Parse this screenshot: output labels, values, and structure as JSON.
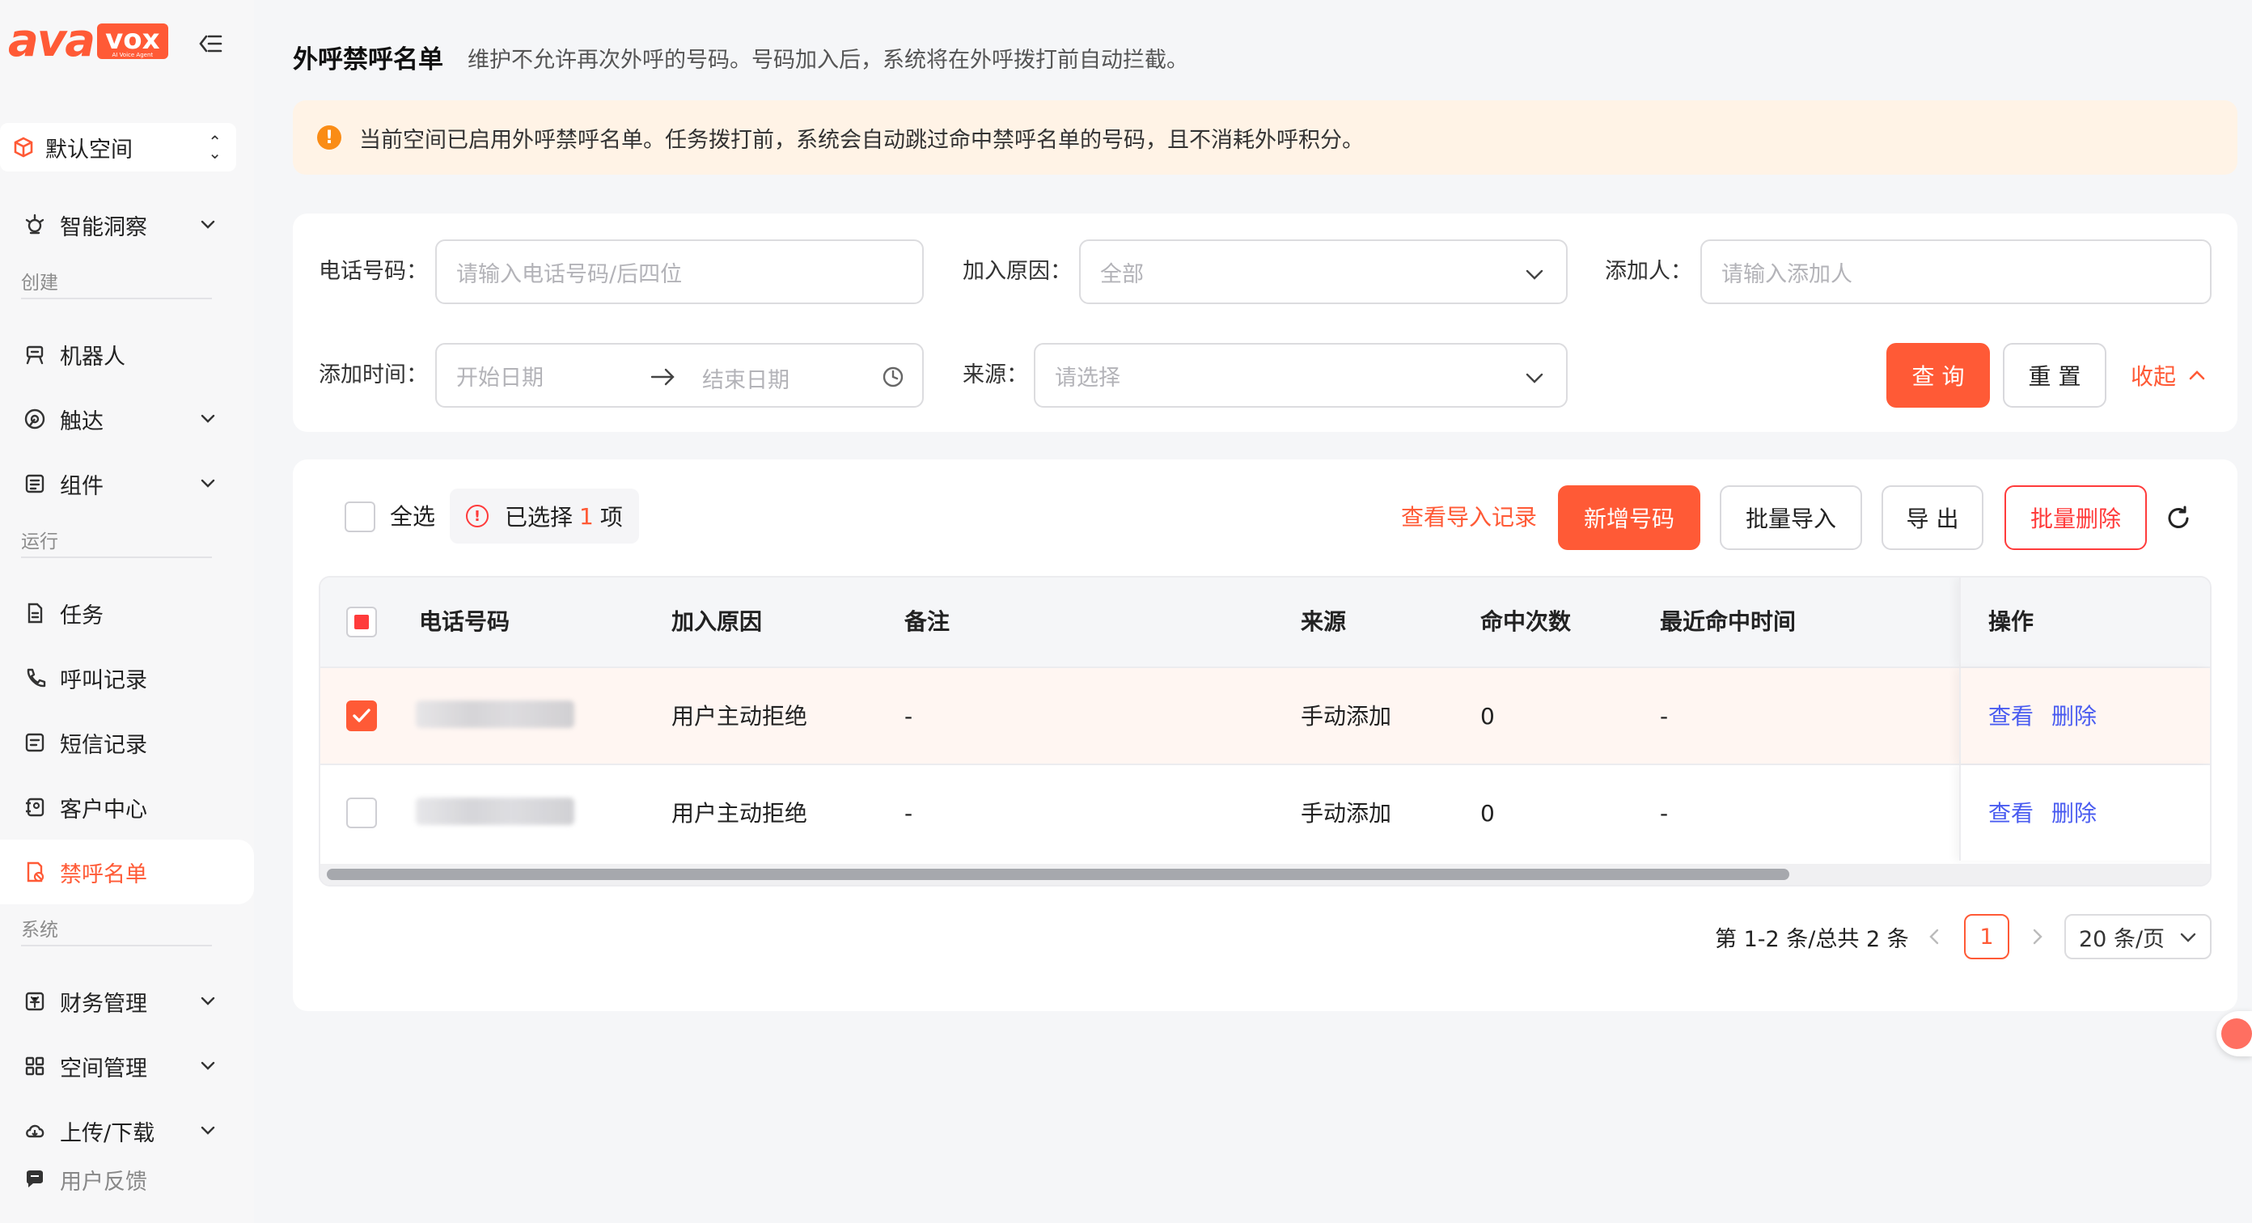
{
  "brand": {
    "logo_ava": "ava",
    "logo_vox": "vox",
    "logo_sub": "AI Voice Agent"
  },
  "sidebar": {
    "space": "默认空间",
    "items": [
      {
        "label": "智能洞察",
        "icon": "insight-icon",
        "has_children": true
      },
      {
        "label": "机器人",
        "icon": "robot-icon"
      },
      {
        "label": "触达",
        "icon": "reach-icon",
        "has_children": true
      },
      {
        "label": "组件",
        "icon": "component-icon",
        "has_children": true
      },
      {
        "label": "任务",
        "icon": "task-icon"
      },
      {
        "label": "呼叫记录",
        "icon": "phone-icon"
      },
      {
        "label": "短信记录",
        "icon": "message-icon"
      },
      {
        "label": "客户中心",
        "icon": "customer-icon"
      },
      {
        "label": "禁呼名单",
        "icon": "blocklist-icon",
        "active": true
      },
      {
        "label": "财务管理",
        "icon": "finance-icon",
        "has_children": true
      },
      {
        "label": "空间管理",
        "icon": "space-icon",
        "has_children": true
      },
      {
        "label": "上传/下载",
        "icon": "cloud-icon",
        "has_children": true
      },
      {
        "label": "用户反馈",
        "icon": "feedback-icon"
      }
    ],
    "groups": {
      "create": "创建",
      "run": "运行",
      "system": "系统"
    }
  },
  "page": {
    "title": "外呼禁呼名单",
    "description": "维护不允许再次外呼的号码。号码加入后，系统将在外呼拨打前自动拦截。",
    "alert": "当前空间已启用外呼禁呼名单。任务拨打前，系统会自动跳过命中禁呼名单的号码，且不消耗外呼积分。"
  },
  "filters": {
    "phone_label": "电话号码：",
    "phone_placeholder": "请输入电话号码/后四位",
    "reason_label": "加入原因：",
    "reason_value": "全部",
    "adder_label": "添加人：",
    "adder_placeholder": "请输入添加人",
    "time_label": "添加时间：",
    "start_placeholder": "开始日期",
    "end_placeholder": "结束日期",
    "source_label": "来源：",
    "source_placeholder": "请选择",
    "query_button": "查 询",
    "reset_button": "重 置",
    "collapse_link": "收起"
  },
  "toolbar": {
    "select_all": "全选",
    "selected_prefix": "已选择",
    "selected_count": "1",
    "selected_suffix": "项",
    "view_import_records": "查看导入记录",
    "add_number": "新增号码",
    "batch_import": "批量导入",
    "export": "导 出",
    "batch_delete": "批量删除"
  },
  "table": {
    "columns": [
      "电话号码",
      "加入原因",
      "备注",
      "来源",
      "命中次数",
      "最近命中时间",
      "操作"
    ],
    "rows": [
      {
        "checked": true,
        "phone": "",
        "reason": "用户主动拒绝",
        "remark": "-",
        "source": "手动添加",
        "hits": "0",
        "last_hit": "-",
        "view": "查看",
        "delete": "删除"
      },
      {
        "checked": false,
        "phone": "",
        "reason": "用户主动拒绝",
        "remark": "-",
        "source": "手动添加",
        "hits": "0",
        "last_hit": "-",
        "view": "查看",
        "delete": "删除"
      }
    ]
  },
  "pagination": {
    "summary": "第 1-2 条/总共 2 条",
    "current_page": "1",
    "page_size": "20 条/页"
  },
  "colors": {
    "brand": "#ff5a36",
    "link": "#4a5cf0",
    "danger": "#ff3b3b",
    "warning": "#fa8c16"
  }
}
